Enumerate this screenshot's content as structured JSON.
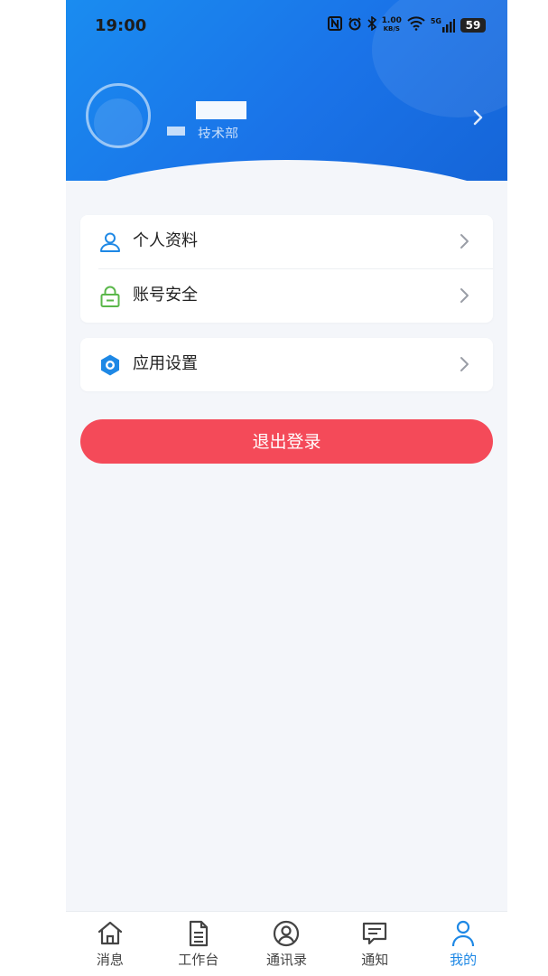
{
  "status_bar": {
    "time": "19:00",
    "net_speed_value": "1.00",
    "net_speed_unit": "KB/S",
    "network": "5G",
    "battery": "59"
  },
  "profile": {
    "department": "技术部"
  },
  "menu": {
    "items": [
      {
        "label": "个人资料",
        "icon": "user-icon"
      },
      {
        "label": "账号安全",
        "icon": "lock-icon"
      },
      {
        "label": "应用设置",
        "icon": "settings-icon"
      }
    ]
  },
  "logout": {
    "label": "退出登录"
  },
  "tabbar": {
    "tabs": [
      {
        "label": "消息",
        "icon": "home-icon"
      },
      {
        "label": "工作台",
        "icon": "document-icon"
      },
      {
        "label": "通讯录",
        "icon": "contacts-icon"
      },
      {
        "label": "通知",
        "icon": "message-icon"
      },
      {
        "label": "我的",
        "icon": "person-icon",
        "active": true
      }
    ]
  },
  "colors": {
    "header_blue": "#1a73e8",
    "logout_red": "#f44a59",
    "active_tab": "#1e88e5",
    "lock_green": "#5ab74a",
    "settings_blue": "#1e88e5"
  }
}
